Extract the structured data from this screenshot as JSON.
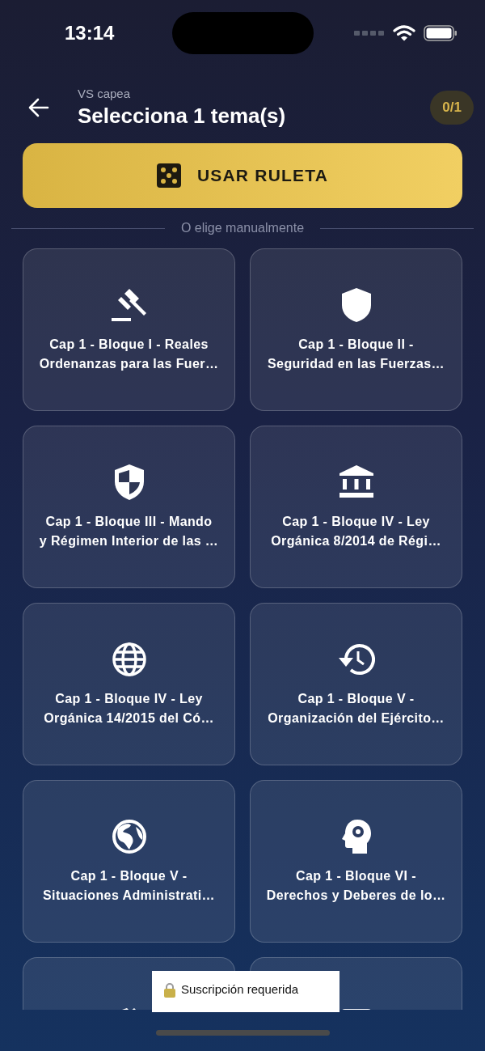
{
  "status_bar": {
    "time": "13:14"
  },
  "header": {
    "subtitle": "VS capea",
    "title": "Selecciona 1 tema(s)",
    "counter": "0/1"
  },
  "roulette_button": {
    "label": "USAR RULETA"
  },
  "divider_label": "O elige manualmente",
  "topics": [
    {
      "kind": "topic",
      "title": "Cap 1 - Bloque I - Reales\nOrdenanzas para las Fuer…"
    },
    {
      "kind": "topic",
      "title": "Cap 1 - Bloque II -\nSeguridad en las Fuerzas…"
    },
    {
      "kind": "topic",
      "title": "Cap 1 - Bloque III - Mando\ny Régimen Interior de las …"
    },
    {
      "kind": "topic",
      "title": "Cap 1 - Bloque IV - Ley\nOrgánica 8/2014 de Régi…"
    },
    {
      "kind": "topic",
      "title": "Cap 1 - Bloque IV - Ley\nOrgánica 14/2015 del Có…"
    },
    {
      "kind": "topic",
      "title": "Cap 1 - Bloque V -\nOrganización del Ejército…"
    },
    {
      "kind": "topic",
      "title": "Cap 1 - Bloque V -\nSituaciones Administrati…"
    },
    {
      "kind": "topic",
      "title": "Cap 1 - Bloque VI -\nDerechos y Deberes de lo…"
    },
    {
      "kind": "partial"
    },
    {
      "kind": "partial"
    }
  ],
  "toast": {
    "text": "Suscripción requerida"
  }
}
